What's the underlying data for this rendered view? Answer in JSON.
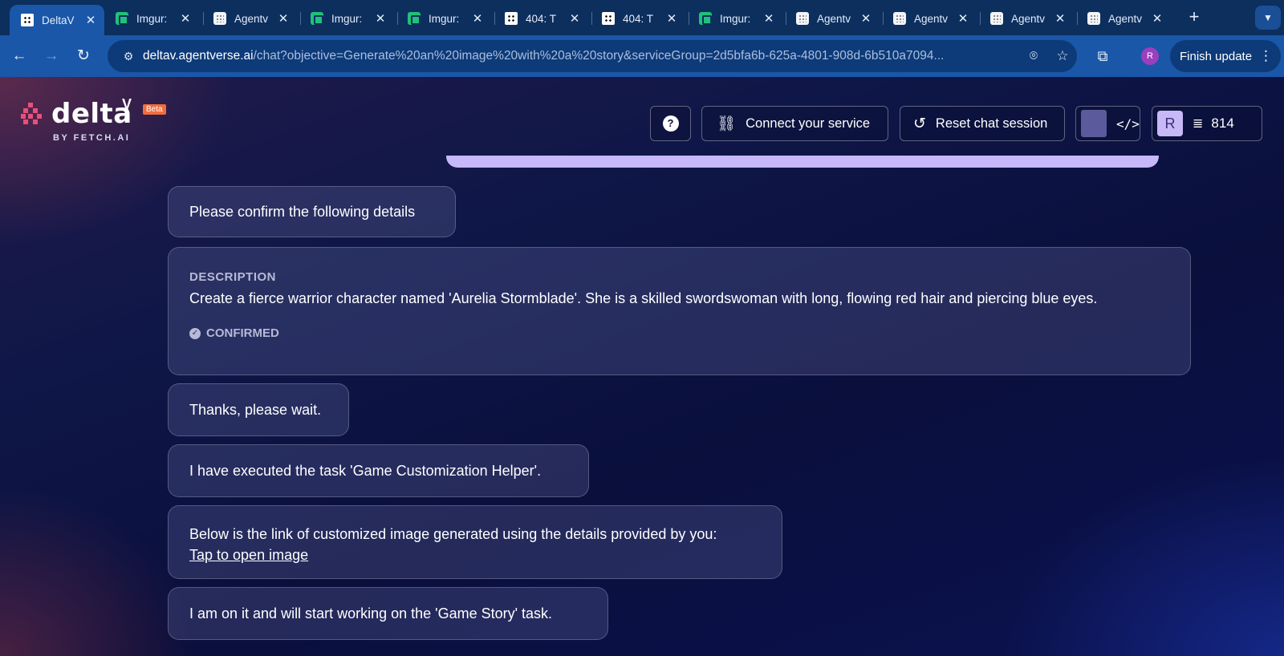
{
  "browser": {
    "tabs": [
      {
        "title": "DeltaV",
        "favicon": "deltav-icon",
        "active": true
      },
      {
        "title": "Imgur:",
        "favicon": "imgur-icon"
      },
      {
        "title": "Agentv",
        "favicon": "agentverse-icon"
      },
      {
        "title": "Imgur:",
        "favicon": "imgur-icon"
      },
      {
        "title": "Imgur:",
        "favicon": "imgur-icon"
      },
      {
        "title": "404: T",
        "favicon": "deltav-icon"
      },
      {
        "title": "404: T",
        "favicon": "deltav-icon"
      },
      {
        "title": "Imgur:",
        "favicon": "imgur-icon"
      },
      {
        "title": "Agentv",
        "favicon": "agentverse-icon"
      },
      {
        "title": "Agentv",
        "favicon": "agentverse-icon"
      },
      {
        "title": "Agentv",
        "favicon": "agentverse-icon"
      },
      {
        "title": "Agentv",
        "favicon": "agentverse-icon"
      }
    ],
    "url_host": "deltav.agentverse.ai",
    "url_path": "/chat?objective=Generate%20an%20image%20with%20a%20story&serviceGroup=2d5bfa6b-625a-4801-908d-6b510a7094...",
    "profile_initial": "R",
    "finish_update_label": "Finish update"
  },
  "header": {
    "logo_text": "delta",
    "logo_sup": "V",
    "beta_badge": "Beta",
    "byline": "BY FETCH.AI",
    "help_label": "?",
    "connect_label": "Connect your service",
    "reset_label": "Reset chat session",
    "code_label": "</>",
    "user_initial": "R",
    "credits": "814"
  },
  "chat": {
    "messages": [
      {
        "text": "Please confirm the following details"
      },
      {
        "type": "details",
        "label": "DESCRIPTION",
        "text": "Create a fierce warrior character named 'Aurelia Stormblade'. She is a skilled swordswoman with long, flowing red hair and piercing blue eyes.",
        "status": "CONFIRMED"
      },
      {
        "text": "Thanks, please wait."
      },
      {
        "text": "I have executed the task 'Game Customization Helper'."
      },
      {
        "text": "Below is the link of customized image generated using the details provided by you:",
        "link": "Tap to open image"
      },
      {
        "text": "I am on it and will start working on the 'Game Story' task."
      }
    ]
  },
  "colors": {
    "accent": "#c6b8fb",
    "beta": "#f26d3d",
    "chrome": "#1a57a8"
  }
}
